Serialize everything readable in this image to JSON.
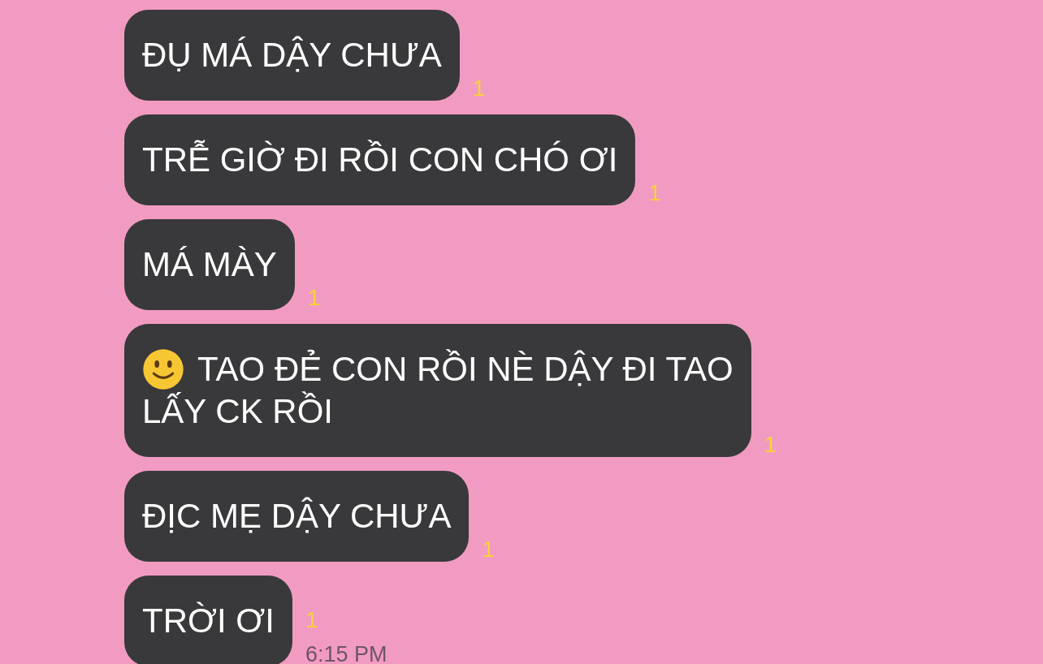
{
  "messages": [
    {
      "kind": "plain",
      "lines": [
        "ĐỤ MÁ DẬY CHƯA"
      ],
      "unread": "1"
    },
    {
      "kind": "plain",
      "lines": [
        "TRỄ GIỜ ĐI RỒI CON CHÓ ƠI"
      ],
      "unread": "1"
    },
    {
      "kind": "plain",
      "lines": [
        "MÁ MÀY"
      ],
      "unread": "1"
    },
    {
      "kind": "emoji",
      "lines": [
        "TAO ĐẺ CON RỒI NÈ DẬY ĐI TAO",
        "LẤY CK RỒI"
      ],
      "unread": "1"
    },
    {
      "kind": "plain",
      "lines": [
        "ĐỊC MẸ DẬY CHƯA"
      ],
      "unread": "1"
    },
    {
      "kind": "plain",
      "lines": [
        "TRỜI ƠI"
      ],
      "unread": "1",
      "time": "6:15 PM"
    }
  ]
}
